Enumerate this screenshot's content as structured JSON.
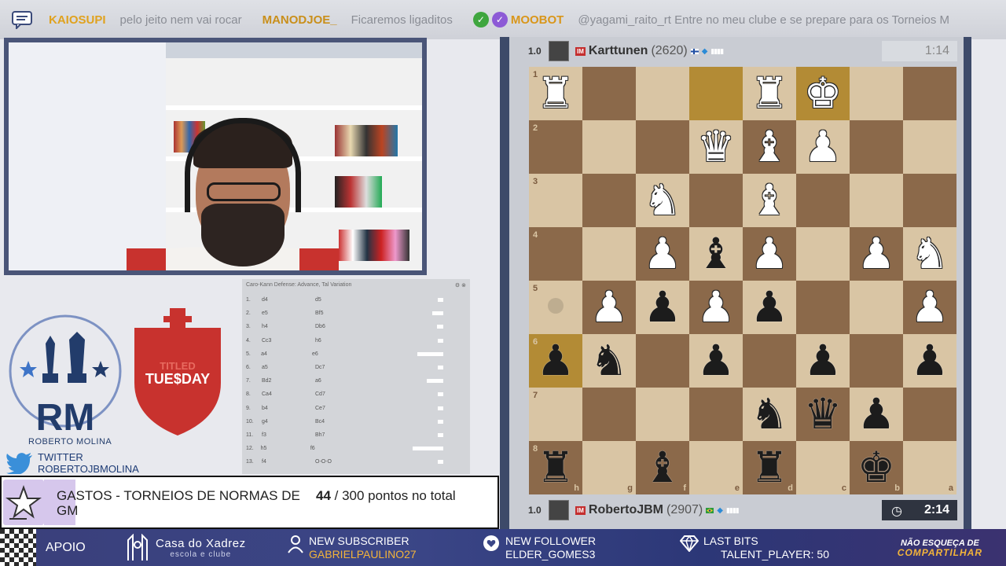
{
  "ticker": {
    "messages": [
      {
        "user": "KAIOSUPI",
        "text": "pelo jeito nem vai rocar",
        "color": "#e0a21e"
      },
      {
        "user": "MANODJOE_",
        "text": "Ficaremos ligaditos",
        "color": "#c98f1a"
      },
      {
        "user": "MOOBOT",
        "text": "@yagami_raito_rt Entre no meu clube e se prepare para os Torneios M",
        "color": "#d9961a"
      }
    ]
  },
  "branding": {
    "rm_name": "ROBERTO MOLINA",
    "titled_line1": "TITLED",
    "titled_line2": "TUE$DAY",
    "twitter_label": "TWITTER",
    "twitter_handle": "ROBERTOJBMOLINA"
  },
  "explorer": {
    "title": "Caro-Kann Defense: Advance, Tal Variation",
    "moves": [
      {
        "n": "1.",
        "w": "d4",
        "b": "d5",
        "bar": 0.05
      },
      {
        "n": "2.",
        "w": "e5",
        "b": "Bf5",
        "bar": 0.1
      },
      {
        "n": "3.",
        "w": "h4",
        "b": "Db6",
        "bar": 0.06
      },
      {
        "n": "4.",
        "w": "Cc3",
        "b": "h6",
        "bar": 0.05
      },
      {
        "n": "5.",
        "w": "a4",
        "b": "e6",
        "bar": 0.25
      },
      {
        "n": "6.",
        "w": "a5",
        "b": "Dc7",
        "bar": 0.05
      },
      {
        "n": "7.",
        "w": "Bd2",
        "b": "a6",
        "bar": 0.15
      },
      {
        "n": "8.",
        "w": "Ca4",
        "b": "Cd7",
        "bar": 0.05
      },
      {
        "n": "9.",
        "w": "b4",
        "b": "Ce7",
        "bar": 0.05
      },
      {
        "n": "10.",
        "w": "g4",
        "b": "Bc4",
        "bar": 0.05
      },
      {
        "n": "11.",
        "w": "f3",
        "b": "Bh7",
        "bar": 0.05
      },
      {
        "n": "12.",
        "w": "h5",
        "b": "f6",
        "bar": 0.3
      },
      {
        "n": "13.",
        "w": "f4",
        "b": "O-O-O",
        "bar": 0.05
      }
    ]
  },
  "goal": {
    "title": "GASTOS - TORNEIOS DE NORMAS DE GM",
    "current": "44",
    "rest": " / 300 pontos no total",
    "progress": 0.147
  },
  "bottom": {
    "apoio": "APOIO",
    "casa_title": "Casa do Xadrez",
    "casa_sub": "escola e clube",
    "alerts": [
      {
        "label": "NEW SUBSCRIBER",
        "value": "GABRIELPAULINO27",
        "value_color": "#f3b43a"
      },
      {
        "label": "NEW FOLLOWER",
        "value": "ELDER_GOMES3",
        "value_color": "#ffffff"
      },
      {
        "label": "LAST BITS",
        "value": "TALENT_PLAYER: 50",
        "value_color": "#ffffff"
      }
    ],
    "share_line1": "NÃO ESQUEÇA DE",
    "share_line2": "COMPARTILHAR"
  },
  "players": {
    "top": {
      "score": "1.0",
      "title": "IM",
      "name": "Karttunen",
      "rating": "(2620)",
      "clock": "1:14"
    },
    "bottom": {
      "score": "1.0",
      "title": "IM",
      "name": "RobertoJBM",
      "rating": "(2907)",
      "clock": "2:14"
    }
  },
  "board": {
    "rank_labels": [
      "1",
      "2",
      "3",
      "4",
      "5",
      "6",
      "7",
      "8"
    ],
    "file_labels": [
      "h",
      "g",
      "f",
      "e",
      "d",
      "c",
      "b",
      "a"
    ],
    "highlights": [
      "0,3",
      "0,5",
      "5,0"
    ],
    "pieces": [
      {
        "r": 0,
        "c": 0,
        "p": "♜",
        "color": "w"
      },
      {
        "r": 0,
        "c": 4,
        "p": "♜",
        "color": "w"
      },
      {
        "r": 0,
        "c": 5,
        "p": "♚",
        "color": "w"
      },
      {
        "r": 1,
        "c": 3,
        "p": "♛",
        "color": "w"
      },
      {
        "r": 1,
        "c": 4,
        "p": "♝",
        "color": "w"
      },
      {
        "r": 1,
        "c": 5,
        "p": "♟",
        "color": "w"
      },
      {
        "r": 2,
        "c": 2,
        "p": "♞",
        "color": "w"
      },
      {
        "r": 2,
        "c": 4,
        "p": "♝",
        "color": "w"
      },
      {
        "r": 3,
        "c": 2,
        "p": "♟",
        "color": "w"
      },
      {
        "r": 3,
        "c": 3,
        "p": "♝",
        "color": "b"
      },
      {
        "r": 3,
        "c": 4,
        "p": "♟",
        "color": "w"
      },
      {
        "r": 3,
        "c": 6,
        "p": "♟",
        "color": "w"
      },
      {
        "r": 3,
        "c": 7,
        "p": "♞",
        "color": "w"
      },
      {
        "r": 4,
        "c": 1,
        "p": "♟",
        "color": "w"
      },
      {
        "r": 4,
        "c": 2,
        "p": "♟",
        "color": "b"
      },
      {
        "r": 4,
        "c": 3,
        "p": "♟",
        "color": "w"
      },
      {
        "r": 4,
        "c": 4,
        "p": "♟",
        "color": "b"
      },
      {
        "r": 4,
        "c": 7,
        "p": "♟",
        "color": "w"
      },
      {
        "r": 5,
        "c": 0,
        "p": "♟",
        "color": "b"
      },
      {
        "r": 5,
        "c": 1,
        "p": "♞",
        "color": "b"
      },
      {
        "r": 5,
        "c": 3,
        "p": "♟",
        "color": "b"
      },
      {
        "r": 5,
        "c": 5,
        "p": "♟",
        "color": "b"
      },
      {
        "r": 5,
        "c": 7,
        "p": "♟",
        "color": "b"
      },
      {
        "r": 6,
        "c": 4,
        "p": "♞",
        "color": "b"
      },
      {
        "r": 6,
        "c": 5,
        "p": "♛",
        "color": "b"
      },
      {
        "r": 6,
        "c": 6,
        "p": "♟",
        "color": "b"
      },
      {
        "r": 7,
        "c": 0,
        "p": "♜",
        "color": "b"
      },
      {
        "r": 7,
        "c": 2,
        "p": "♝",
        "color": "b"
      },
      {
        "r": 7,
        "c": 4,
        "p": "♜",
        "color": "b"
      },
      {
        "r": 7,
        "c": 6,
        "p": "♚",
        "color": "b"
      }
    ]
  }
}
